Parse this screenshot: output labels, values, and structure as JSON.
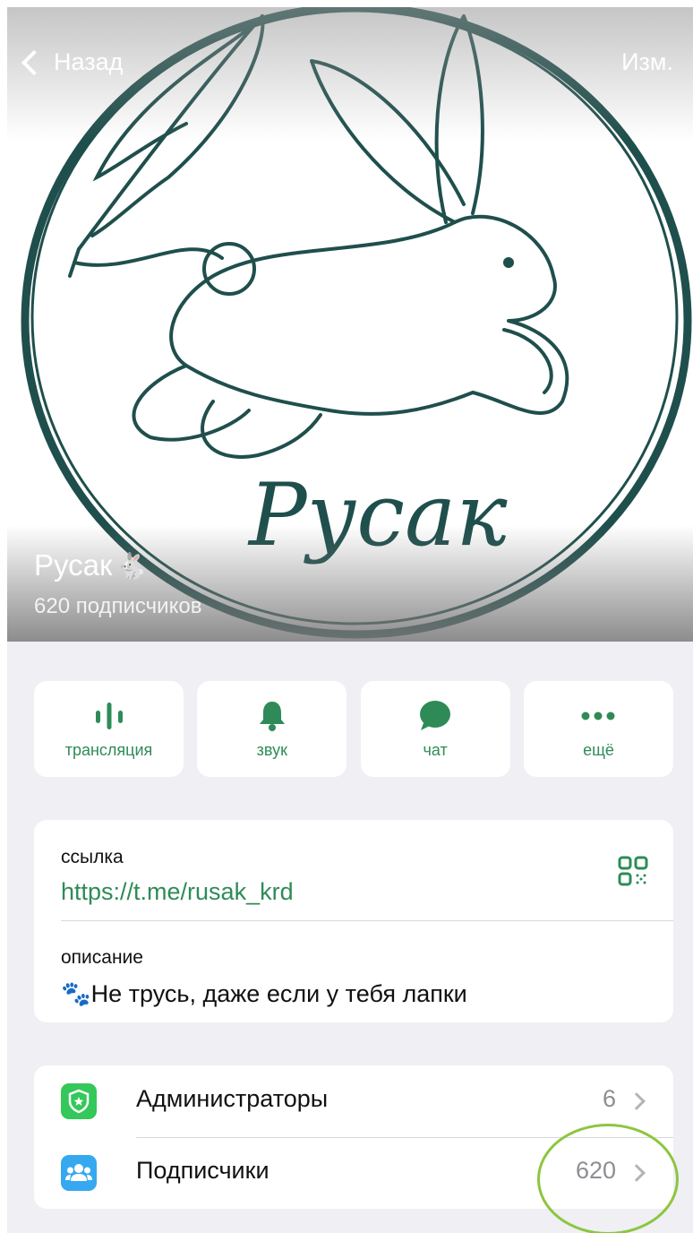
{
  "nav": {
    "back_label": "Назад",
    "edit_label": "Изм."
  },
  "cover": {
    "logo_text": "Русак"
  },
  "channel": {
    "title": "Русак",
    "title_emoji": "🐇",
    "subscribers_text": "620 подписчиков"
  },
  "actions": [
    {
      "label": "трансляция",
      "icon": "broadcast-icon"
    },
    {
      "label": "звук",
      "icon": "bell-icon"
    },
    {
      "label": "чат",
      "icon": "chat-icon"
    },
    {
      "label": "ещё",
      "icon": "more-icon"
    }
  ],
  "info": {
    "link_label": "ссылка",
    "link_value": "https://t.me/rusak_krd",
    "description_label": "описание",
    "description_value": "🐾Не трусь, даже если у тебя лапки"
  },
  "list": [
    {
      "label": "Администраторы",
      "count": "6",
      "icon": "admin-shield-icon",
      "color": "#34c759"
    },
    {
      "label": "Подписчики",
      "count": "620",
      "icon": "subscribers-icon",
      "color": "#36a8f0"
    }
  ],
  "colors": {
    "accent": "#2e8b57",
    "logo": "#1f4f4c",
    "background": "#efeff4",
    "annotation": "#8cc63f"
  }
}
